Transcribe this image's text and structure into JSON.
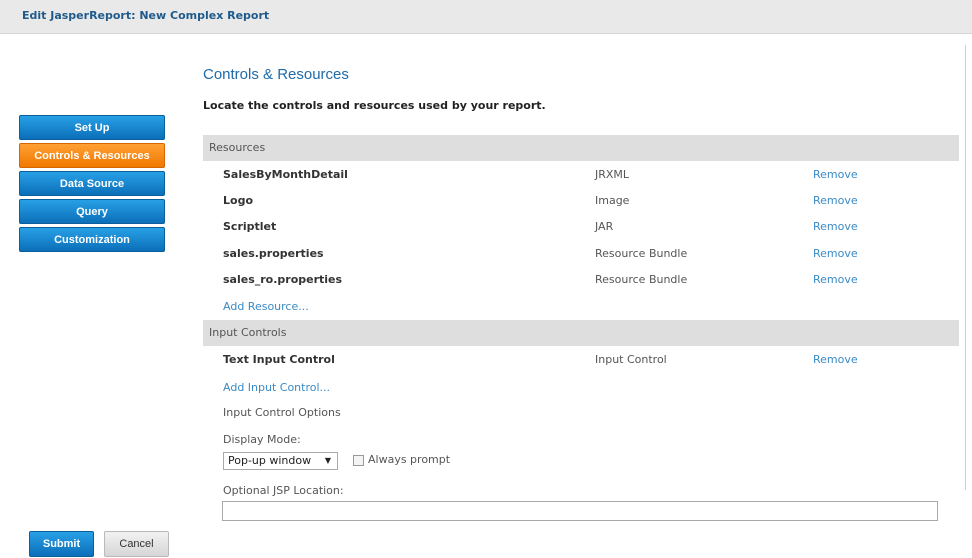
{
  "window": {
    "title": "Edit JasperReport: New Complex Report"
  },
  "nav": {
    "items": [
      {
        "label": "Set Up"
      },
      {
        "label": "Controls & Resources"
      },
      {
        "label": "Data Source"
      },
      {
        "label": "Query"
      },
      {
        "label": "Customization"
      }
    ],
    "active": "Controls & Resources"
  },
  "main": {
    "title": "Controls & Resources",
    "instructions": "Locate the controls and resources used by your report.",
    "resources": {
      "header": "Resources",
      "rows": [
        {
          "name": "SalesByMonthDetail",
          "type": "JRXML",
          "action": "Remove"
        },
        {
          "name": "Logo",
          "type": "Image",
          "action": "Remove"
        },
        {
          "name": "Scriptlet",
          "type": "JAR",
          "action": "Remove"
        },
        {
          "name": "sales.properties",
          "type": "Resource Bundle",
          "action": "Remove"
        },
        {
          "name": "sales_ro.properties",
          "type": "Resource Bundle",
          "action": "Remove"
        }
      ],
      "add_link": "Add Resource..."
    },
    "input_controls": {
      "header": "Input Controls",
      "rows": [
        {
          "name": "Text Input Control",
          "type": "Input Control",
          "action": "Remove"
        }
      ],
      "add_link": "Add Input Control...",
      "options_label": "Input Control Options",
      "display_mode_label": "Display Mode:",
      "display_mode_value": "Pop-up window",
      "always_prompt_label": "Always prompt",
      "always_prompt_checked": false,
      "jsp_location_label": "Optional JSP Location:",
      "jsp_location_value": ""
    }
  },
  "footer": {
    "submit_label": "Submit",
    "cancel_label": "Cancel"
  },
  "colors": {
    "nav_blue": "#0b6fb9",
    "nav_active_orange": "#f07800",
    "link_blue": "#3a8ac5",
    "title_blue": "#1f6aa8",
    "section_header_bg": "#dedede"
  }
}
